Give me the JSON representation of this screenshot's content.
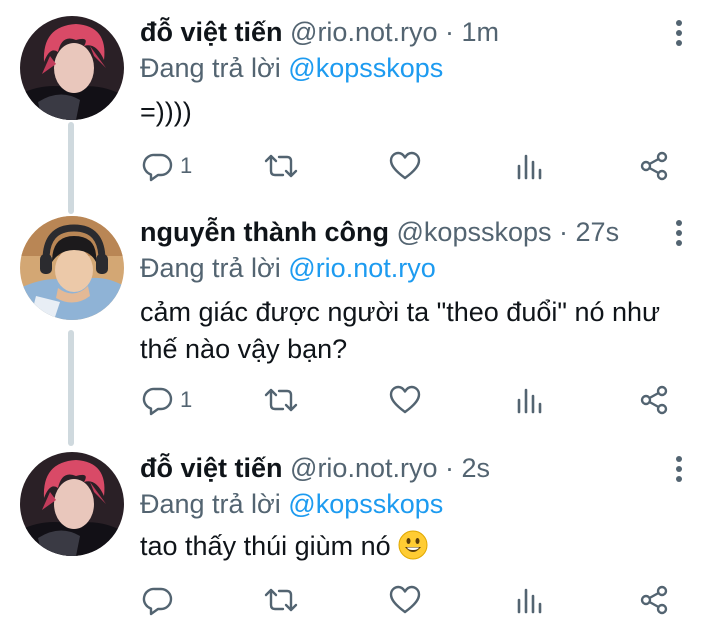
{
  "tweets": [
    {
      "name": "đỗ việt tiến",
      "handle": "@rio.not.ryo",
      "separator": "·",
      "time": "1m",
      "reply_prefix": "Đang trả lời",
      "reply_to": "@kopsskops",
      "text": "=))))",
      "reply_count": "1",
      "avatar": "red-haired-avatar"
    },
    {
      "name": "nguyễn thành công",
      "handle": "@kopsskops",
      "separator": "·",
      "time": "27s",
      "reply_prefix": "Đang trả lời",
      "reply_to": "@rio.not.ryo",
      "text": "cảm giác được người ta \"theo đuổi\" nó như thế nào vậy bạn?",
      "reply_count": "1",
      "avatar": "headphones-avatar"
    },
    {
      "name": "đỗ việt tiến",
      "handle": "@rio.not.ryo",
      "separator": "·",
      "time": "2s",
      "reply_prefix": "Đang trả lời",
      "reply_to": "@kopsskops",
      "text": "tao thấy thúi giùm nó",
      "emoji": "grinning-face-emoji",
      "reply_count": "",
      "avatar": "red-haired-avatar"
    }
  ],
  "icons": {
    "more": "more-vertical-icon",
    "reply": "reply-icon",
    "retweet": "retweet-icon",
    "like": "heart-icon",
    "analytics": "analytics-icon",
    "share": "share-icon"
  },
  "colors": {
    "mention": "#1d9bf0",
    "secondary_text": "#536471",
    "icon": "#536471",
    "thread_line": "#cfd9de"
  }
}
